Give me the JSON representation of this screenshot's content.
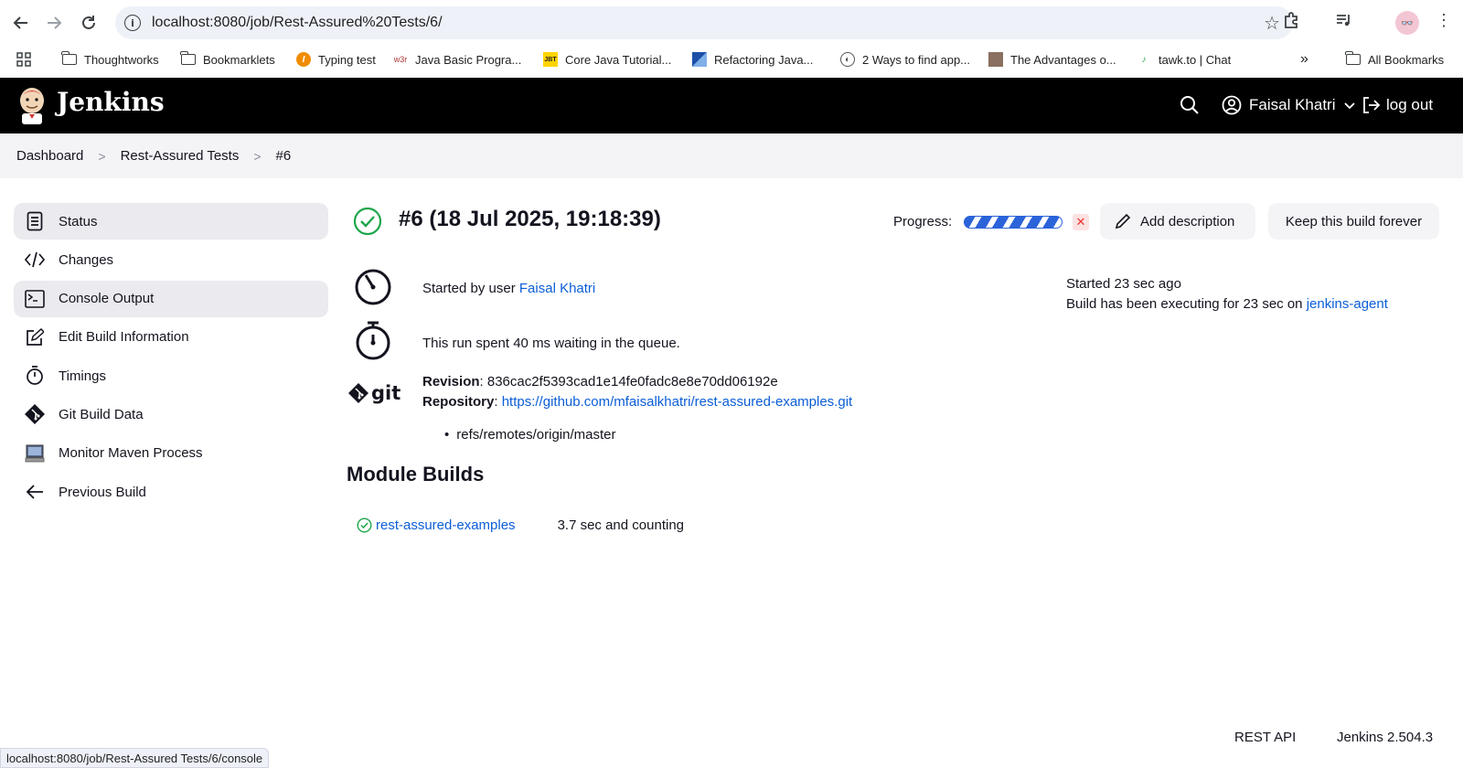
{
  "browser": {
    "url": "localhost:8080/job/Rest-Assured%20Tests/6/",
    "status_url": "localhost:8080/job/Rest-Assured Tests/6/console",
    "bookmarks": [
      {
        "label": "Thoughtworks",
        "icon": "folder-icon"
      },
      {
        "label": "Bookmarklets",
        "icon": "folder-icon"
      },
      {
        "label": "Typing test",
        "icon": "typing-icon"
      },
      {
        "label": "Java Basic Progra...",
        "icon": "w3r-icon"
      },
      {
        "label": "Core Java Tutorial...",
        "icon": "jbt-icon"
      },
      {
        "label": "Refactoring Java...",
        "icon": "refactoring-icon"
      },
      {
        "label": "2 Ways to find app...",
        "icon": "globe-icon"
      },
      {
        "label": "The Advantages o...",
        "icon": "person-icon"
      },
      {
        "label": "tawk.to | Chat",
        "icon": "tawk-icon"
      }
    ],
    "all_bookmarks": "All Bookmarks",
    "overflow": "»"
  },
  "header": {
    "brand": "Jenkins",
    "user": "Faisal Khatri",
    "logout": "log out"
  },
  "breadcrumb": {
    "items": [
      "Dashboard",
      "Rest-Assured Tests",
      "#6"
    ]
  },
  "sidebar": {
    "items": [
      {
        "label": "Status",
        "icon": "document-icon"
      },
      {
        "label": "Changes",
        "icon": "code-icon"
      },
      {
        "label": "Console Output",
        "icon": "terminal-icon"
      },
      {
        "label": "Edit Build Information",
        "icon": "edit-icon"
      },
      {
        "label": "Timings",
        "icon": "stopwatch-icon"
      },
      {
        "label": "Git Build Data",
        "icon": "git-icon"
      },
      {
        "label": "Monitor Maven Process",
        "icon": "computer-icon"
      },
      {
        "label": "Previous Build",
        "icon": "arrow-left-icon"
      }
    ]
  },
  "build": {
    "title": "#6 (18 Jul 2025, 19:18:39)",
    "progress_label": "Progress:",
    "add_description": "Add description",
    "keep_forever": "Keep this build forever",
    "started_by_prefix": "Started by user ",
    "started_by_user": "Faisal Khatri",
    "queue_text": "This run spent 40 ms waiting in the queue.",
    "revision_label": "Revision",
    "revision_value": ": 836cac2f5393cad1e14fe0fadc8e8e70dd06192e",
    "repository_label": "Repository",
    "repository_sep": ": ",
    "repository_url": "https://github.com/mfaisalkhatri/rest-assured-examples.git",
    "branch": "refs/remotes/origin/master",
    "started_ago": "Started 23 sec ago",
    "executing_prefix": "Build has been executing for 23 sec on ",
    "agent": "jenkins-agent",
    "git_text": "git"
  },
  "modules": {
    "title": "Module Builds",
    "items": [
      {
        "name": "rest-assured-examples",
        "duration": "3.7 sec and counting"
      }
    ]
  },
  "footer": {
    "rest_api": "REST API",
    "version": "Jenkins 2.504.3"
  },
  "colors": {
    "link": "#0b5ed7",
    "success": "#1ea64b",
    "header_bg": "#000000"
  }
}
